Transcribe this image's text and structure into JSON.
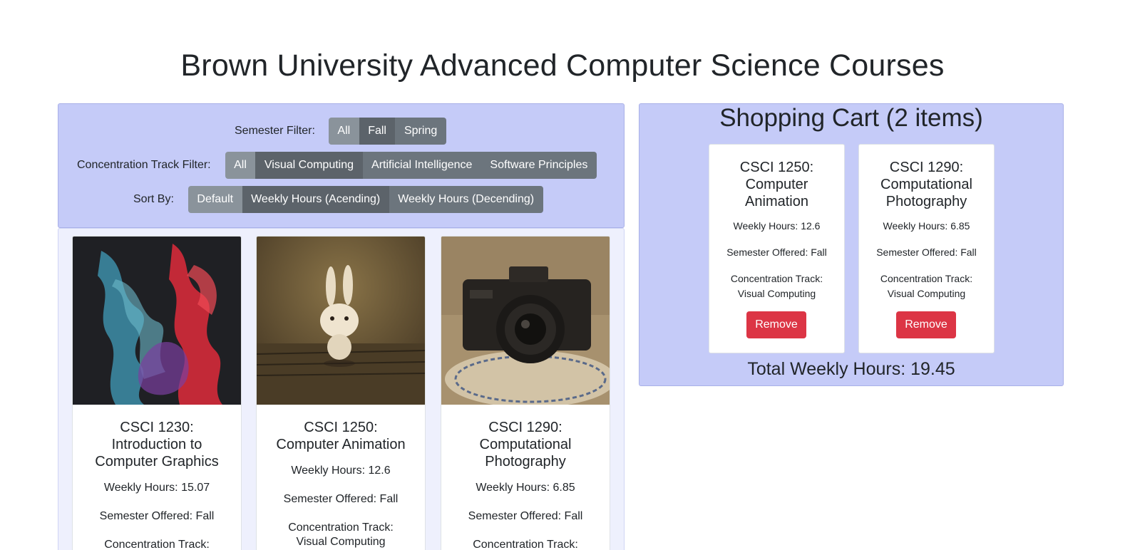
{
  "page": {
    "title": "Brown University Advanced Computer Science Courses"
  },
  "filters": {
    "semester_label": "Semester Filter:",
    "semester_options": [
      "All",
      "Fall",
      "Spring"
    ],
    "semester_selected": "All",
    "track_label": "Concentration Track Filter:",
    "track_options": [
      "All",
      "Visual Computing",
      "Artificial Intelligence",
      "Software Principles"
    ],
    "track_selected": "All",
    "sort_label": "Sort By:",
    "sort_options": [
      "Default",
      "Weekly Hours (Acending)",
      "Weekly Hours (Decending)"
    ],
    "sort_selected": "Default"
  },
  "courses": [
    {
      "title": "CSCI 1230: Introduction to Computer Graphics",
      "weekly_hours": "Weekly Hours: 15.07",
      "semester": "Semester Offered: Fall",
      "track": "Concentration Track:",
      "image": "colored-smoke-image"
    },
    {
      "title": "CSCI 1250: Computer Animation",
      "weekly_hours": "Weekly Hours: 12.6",
      "semester": "Semester Offered: Fall",
      "track": "Concentration Track: Visual Computing",
      "image": "bunny-figure-image"
    },
    {
      "title": "CSCI 1290: Computational Photography",
      "weekly_hours": "Weekly Hours: 6.85",
      "semester": "Semester Offered: Fall",
      "track": "Concentration Track:",
      "image": "camera-image"
    }
  ],
  "cart": {
    "title": "Shopping Cart (2 items)",
    "items": [
      {
        "title": "CSCI 1250: Computer Animation",
        "weekly_hours": "Weekly Hours: 12.6",
        "semester": "Semester Offered: Fall",
        "track": "Concentration Track: Visual Computing",
        "remove_label": "Remove"
      },
      {
        "title": "CSCI 1290: Computational Photography",
        "weekly_hours": "Weekly Hours: 6.85",
        "semester": "Semester Offered: Fall",
        "track": "Concentration Track: Visual Computing",
        "remove_label": "Remove"
      }
    ],
    "total": "Total Weekly Hours: 19.45"
  },
  "colors": {
    "panel_bg": "#c5cbf8",
    "button_secondary": "#6c757d",
    "button_danger": "#dc3545"
  }
}
